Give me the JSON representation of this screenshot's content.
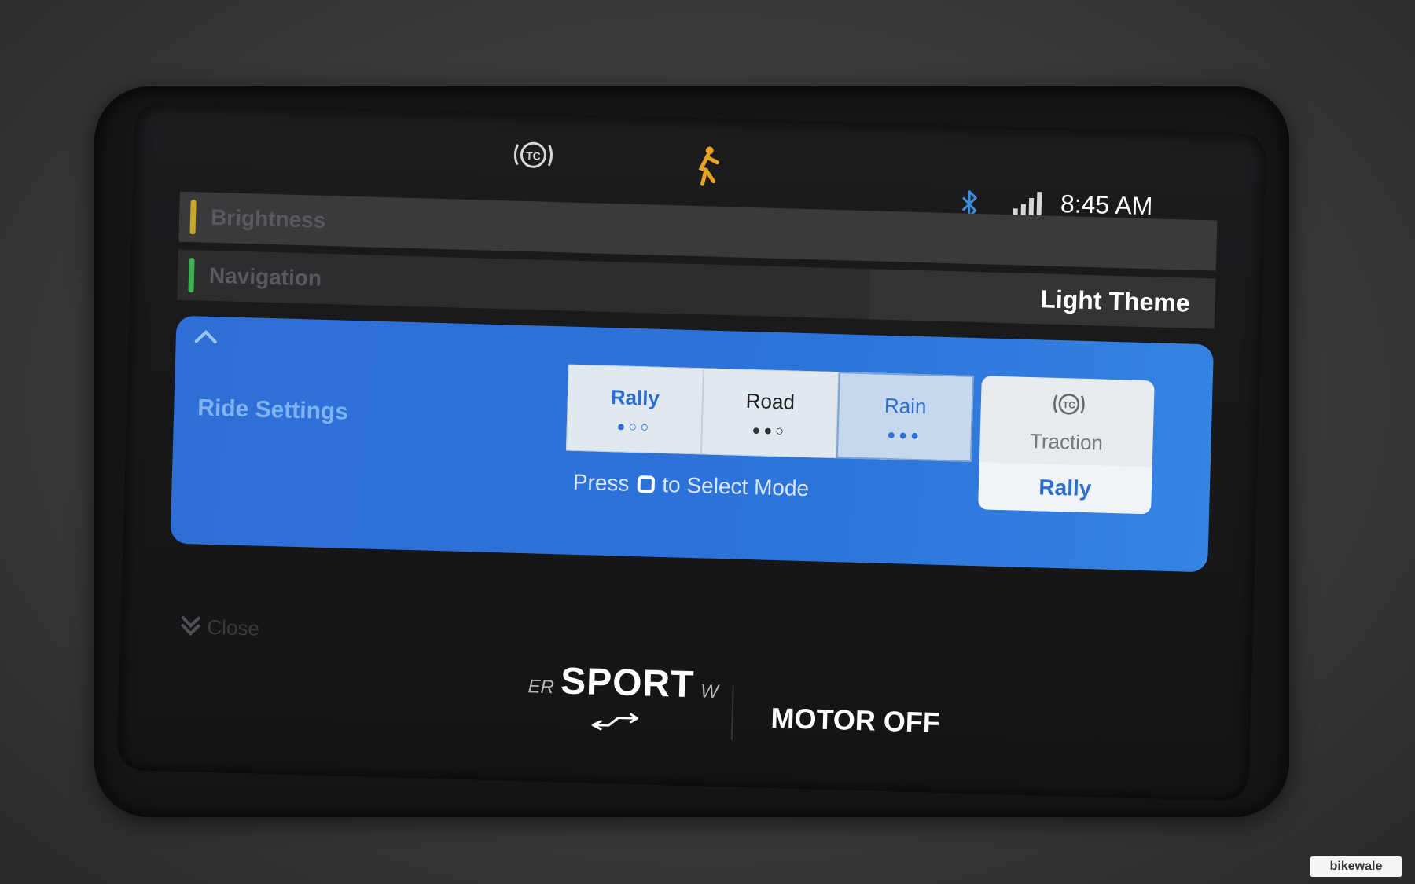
{
  "status_bar": {
    "clock": "8:45 AM",
    "icons": {
      "traction_control": "tc-warning-icon",
      "rider_alert": "rider-icon",
      "bluetooth": "bluetooth-icon",
      "signal": "signal-bars-icon"
    },
    "colors": {
      "rider_alert": "#e8a322",
      "bluetooth": "#3b8de0"
    }
  },
  "menu": {
    "brightness_label": "Brightness",
    "navigation_label": "Navigation",
    "theme_value": "Light Theme",
    "accent_colors": {
      "brightness": "#c9a828",
      "navigation": "#3fae55"
    }
  },
  "ride_settings": {
    "label": "Ride Settings",
    "modes": [
      {
        "label": "Rally",
        "dots": "●○○"
      },
      {
        "label": "Road",
        "dots": "●●○"
      },
      {
        "label": "Rain",
        "dots": "●●●"
      }
    ],
    "selected_mode": "Rain",
    "hint_before": "Press",
    "hint_after": "to Select Mode",
    "traction": {
      "icon_text": "TC",
      "label": "Traction",
      "value": "Rally"
    },
    "panel_color": "#2e6fd6"
  },
  "close_label": "Close",
  "drive": {
    "left_letters": "ER",
    "mode": "SPORT",
    "right_letter": "W"
  },
  "motor_status": "MOTOR OFF",
  "watermark": "bikewale"
}
